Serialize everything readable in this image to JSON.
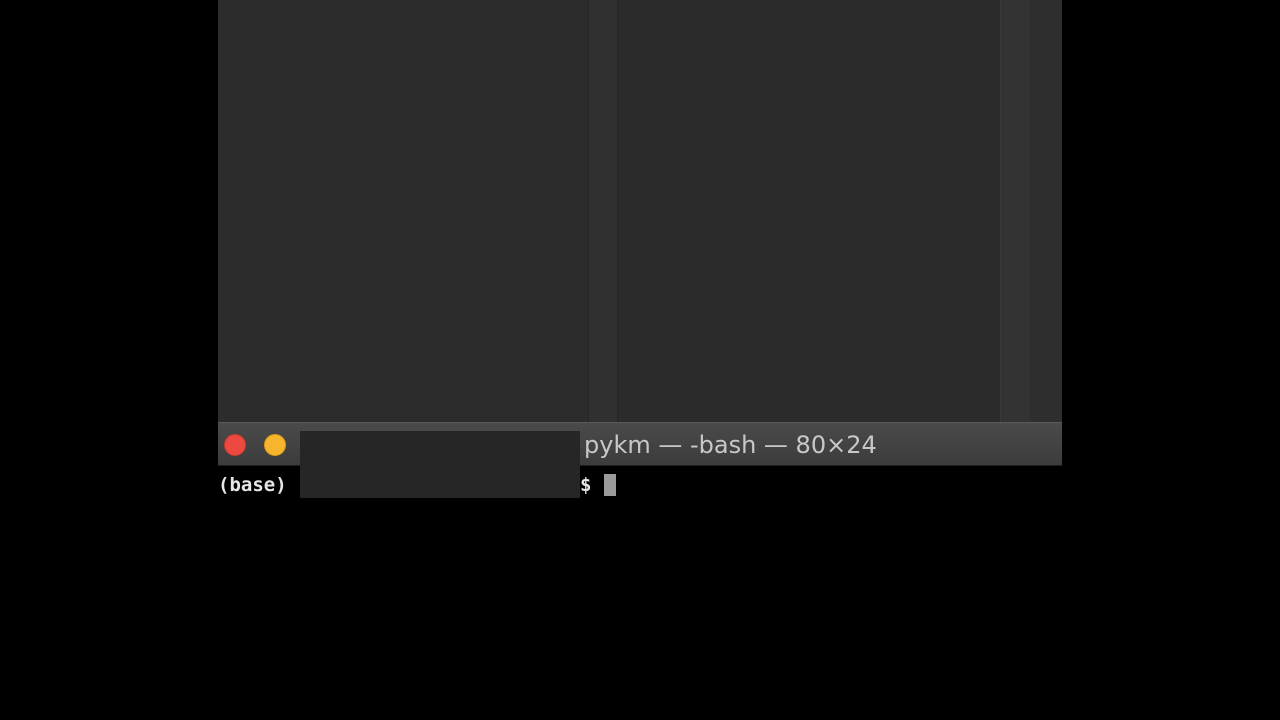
{
  "terminal": {
    "title": "pykm — -bash — 80×24",
    "prompt_env": "(base)",
    "prompt_symbol": "$"
  },
  "colors": {
    "close_button": "#ec4a40",
    "minimize_button": "#f6b52c",
    "terminal_background": "#000000",
    "titlebar_background": "#444444"
  },
  "icons": {
    "close": "close-icon",
    "minimize": "minimize-icon"
  }
}
